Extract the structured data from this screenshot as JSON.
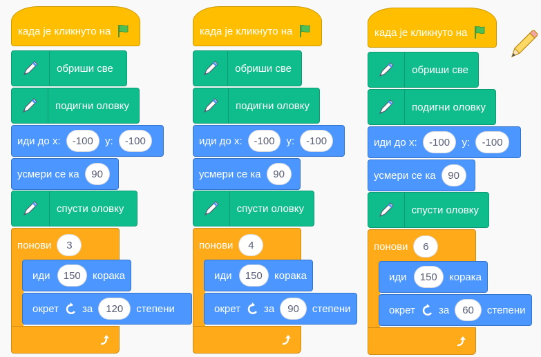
{
  "scripts": [
    {
      "hat_label": "када је кликнуто на",
      "erase_label": "обриши све",
      "pen_up_label": "подигни оловку",
      "goto_label": "иди до x:",
      "goto_x": "-100",
      "goto_y_label": "y:",
      "goto_y": "-100",
      "point_label": "усмери се ка",
      "point_value": "90",
      "pen_down_label": "спусти оловку",
      "repeat_label": "понови",
      "repeat_count": "3",
      "move_label": "иди",
      "move_steps": "150",
      "move_unit": "корака",
      "turn_label": "окрет",
      "turn_by": "за",
      "turn_degrees": "120",
      "turn_unit": "степени"
    },
    {
      "hat_label": "када је кликнуто на",
      "erase_label": "обриши све",
      "pen_up_label": "подигни оловку",
      "goto_label": "иди до x:",
      "goto_x": "-100",
      "goto_y_label": "y:",
      "goto_y": "-100",
      "point_label": "усмери се ка",
      "point_value": "90",
      "pen_down_label": "спусти оловку",
      "repeat_label": "понови",
      "repeat_count": "4",
      "move_label": "иди",
      "move_steps": "150",
      "move_unit": "корака",
      "turn_label": "окрет",
      "turn_by": "за",
      "turn_degrees": "90",
      "turn_unit": "степени"
    },
    {
      "hat_label": "када је кликнуто на",
      "erase_label": "обриши све",
      "pen_up_label": "подигни оловку",
      "goto_label": "иди до x:",
      "goto_x": "-100",
      "goto_y_label": "y:",
      "goto_y": "-100",
      "point_label": "усмери се ка",
      "point_value": "90",
      "pen_down_label": "спусти оловку",
      "repeat_label": "понови",
      "repeat_count": "6",
      "move_label": "иди",
      "move_steps": "150",
      "move_unit": "корака",
      "turn_label": "окрет",
      "turn_by": "за",
      "turn_degrees": "60",
      "turn_unit": "степени"
    }
  ],
  "colors": {
    "events": "#ffbf00",
    "pen": "#0fbd8c",
    "motion": "#4c97ff",
    "control": "#ffab19"
  },
  "icons": [
    "green-flag-icon",
    "pen-icon",
    "turn-left-icon",
    "repeat-arrow-icon",
    "pencil-cursor-icon"
  ]
}
